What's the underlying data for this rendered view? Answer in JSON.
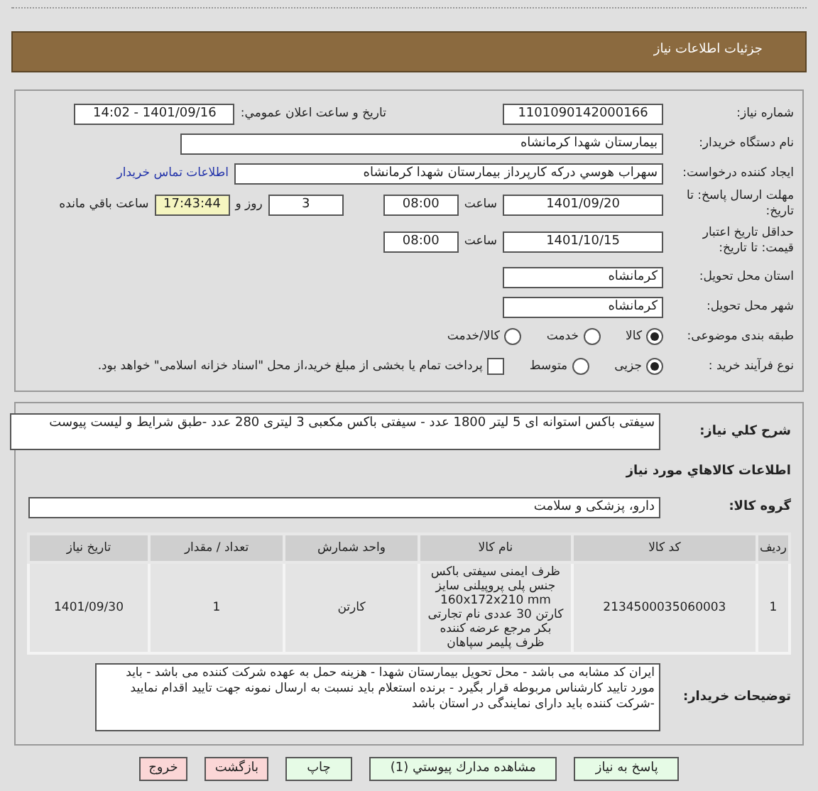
{
  "page_title": "جزئيات اطلاعات نياز",
  "need_number": {
    "label": "شماره نياز:",
    "value": "1101090142000166"
  },
  "announce": {
    "label": "تاريخ و ساعت اعلان عمومي:",
    "value": "1401/09/16 - 14:02"
  },
  "buyer": {
    "label": "نام دستگاه خريدار:",
    "value": "بيمارستان شهدا كرمانشاه"
  },
  "creator": {
    "label": "ايجاد كننده درخواست:",
    "value": "سهراب هوسي دركه كارپرداز بيمارستان شهدا كرمانشاه",
    "link": "اطلاعات تماس خريدار"
  },
  "deadline": {
    "label": "مهلت ارسال پاسخ: تا تاريخ:",
    "date": "1401/09/20",
    "time_label": "ساعت",
    "time": "08:00",
    "days": "3",
    "days_label": "روز و",
    "remaining": "17:43:44",
    "remaining_label": "ساعت باقي مانده"
  },
  "validity": {
    "label": "حداقل تاريخ اعتبار قيمت: تا تاريخ:",
    "date": "1401/10/15",
    "time_label": "ساعت",
    "time": "08:00"
  },
  "province": {
    "label": "استان محل تحويل:",
    "value": "كرمانشاه"
  },
  "city": {
    "label": "شهر محل تحويل:",
    "value": "كرمانشاه"
  },
  "category": {
    "label": "طبقه بندی موضوعی:",
    "options": [
      {
        "label": "كالا",
        "selected": true
      },
      {
        "label": "خدمت",
        "selected": false
      },
      {
        "label": "كالا/خدمت",
        "selected": false
      }
    ]
  },
  "purchase_type": {
    "label": "نوع فرآيند خريد :",
    "options": [
      {
        "label": "جزيی",
        "selected": true
      },
      {
        "label": "متوسط",
        "selected": false
      }
    ],
    "treasury": {
      "label": "پرداخت تمام يا بخشی از مبلغ خريد،از محل \"اسناد خزانه اسلامی\" خواهد بود.",
      "checked": false
    }
  },
  "description": {
    "label": "شرح كلي نياز:",
    "value": "سيفتی باكس استوانه ای 5 ليتر 1800 عدد - سيفتی باكس مكعبی 3 ليتری 280 عدد -طبق شرايط و ليست پيوست"
  },
  "goods_heading": "اطلاعات كالاهاي مورد نياز",
  "goods_group": {
    "label": "گروه كالا:",
    "value": "دارو، پزشكی و سلامت"
  },
  "table": {
    "columns": [
      "رديف",
      "كد كالا",
      "نام كالا",
      "واحد شمارش",
      "تعداد / مقدار",
      "تاريخ نياز"
    ],
    "rows": [
      [
        "1",
        "2134500035060003",
        "ظرف ايمنی سيفتی باكس جنس پلی پروپيلنی سايز 160x172x210 mm كارتن 30 عددی نام تجارتی بكر مرجع عرضه كننده ظرف پليمر سپاهان",
        "كارتن",
        "1",
        "1401/09/30"
      ]
    ]
  },
  "notes": {
    "label": "توضيحات خريدار:",
    "value": "ايران كد مشابه می باشد - محل تحويل بيمارستان شهدا - هزينه حمل به عهده شركت كننده می باشد - بايد مورد تاييد كارشناس مربوطه قرار بگيرد - برنده استعلام بايد نسبت به ارسال نمونه جهت تاييد اقدام نماييد -شركت كننده  بايد دارای نمايندگی در استان باشد"
  },
  "buttons": [
    {
      "label": "پاسخ به نياز",
      "kind": "action"
    },
    {
      "label": "مشاهده مدارك پيوستي (1)",
      "kind": "action"
    },
    {
      "label": "چاپ",
      "kind": "action"
    },
    {
      "label": "بازگشت",
      "kind": "exit"
    },
    {
      "label": "خروج",
      "kind": "exit"
    }
  ]
}
